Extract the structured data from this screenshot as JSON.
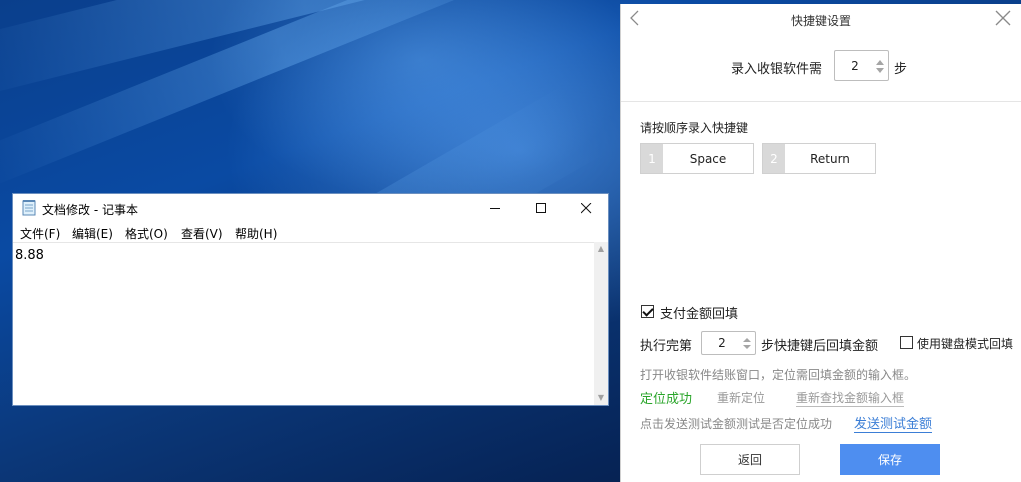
{
  "notepad": {
    "title": "文档修改 - 记事本",
    "menu": [
      "文件(F)",
      "编辑(E)",
      "格式(O)",
      "查看(V)",
      "帮助(H)"
    ],
    "content": "8.88"
  },
  "panel": {
    "title": "快捷键设置",
    "steps_prefix": "录入收银软件需",
    "steps_value": "2",
    "steps_suffix": "步",
    "sequence_label": "请按顺序录入快捷键",
    "keys": [
      {
        "index": "1",
        "name": "Space"
      },
      {
        "index": "2",
        "name": "Return"
      }
    ],
    "fill_amount_label": "支付金额回填",
    "fill_amount_checked": true,
    "after_step_prefix": "执行完第",
    "after_step_value": "2",
    "after_step_suffix": "步快捷键后回填金额",
    "keyboard_mode_label": "使用键盘模式回填",
    "keyboard_mode_checked": false,
    "hint_text": "打开收银软件结账窗口，定位需回填金额的输入框。",
    "locate_success": "定位成功",
    "relocate": "重新定位",
    "refind_input": "重新查找金额输入框",
    "test_hint": "点击发送测试金额测试是否定位成功",
    "send_test": "发送测试金额",
    "back_button": "返回",
    "save_button": "保存"
  },
  "colors": {
    "accent": "#4e8ef0",
    "success": "#2aa52a",
    "link": "#3b7ed6"
  }
}
